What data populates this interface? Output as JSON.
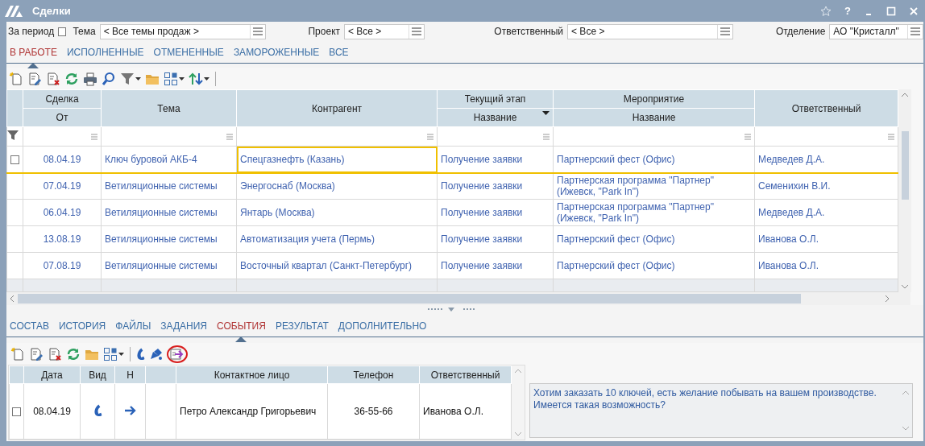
{
  "window": {
    "title": "Сделки",
    "help": "?"
  },
  "filters": {
    "period": {
      "label": "За период",
      "checked": false
    },
    "fields": [
      {
        "label": "Тема",
        "value": "< Все темы продаж >"
      },
      {
        "label": "Проект",
        "value": "< Все >"
      },
      {
        "label": "Ответственный",
        "value": "< Все >"
      },
      {
        "label": "Отделение",
        "value": "АО \"Кристалл\""
      }
    ]
  },
  "tabs": [
    {
      "label": "В РАБОТЕ",
      "selected": true
    },
    {
      "label": "ИСПОЛНЕННЫЕ",
      "selected": false
    },
    {
      "label": "ОТМЕНЕННЫЕ",
      "selected": false
    },
    {
      "label": "ЗАМОРОЖЕННЫЕ",
      "selected": false
    },
    {
      "label": "ВСЕ",
      "selected": false
    }
  ],
  "toolbar": [
    {
      "kind": "new"
    },
    {
      "kind": "edit"
    },
    {
      "kind": "delete"
    },
    {
      "kind": "refresh"
    },
    {
      "kind": "print"
    },
    {
      "kind": "search"
    },
    {
      "kind": "filter"
    },
    {
      "kind": "folder"
    },
    {
      "kind": "layout"
    },
    {
      "kind": "sort"
    }
  ],
  "table": {
    "columns": [
      {
        "group": "Сделка",
        "title": "От",
        "sorted": false
      },
      {
        "title": "Тема",
        "sorted": false
      },
      {
        "title": "Контрагент",
        "sorted": false
      },
      {
        "group": "Текущий этап",
        "title": "Название",
        "sorted": true
      },
      {
        "group": "Мероприятие",
        "title": "Название",
        "sorted": false
      },
      {
        "title": "Ответственный",
        "sorted": false
      }
    ],
    "rows": [
      {
        "selected": true,
        "cells": [
          "08.04.19",
          "Ключ буровой АКБ-4",
          "Спецгазнефть (Казань)",
          "Получение заявки",
          "Партнерский фест (Офис)",
          "Медведев Д.А."
        ]
      },
      {
        "selected": false,
        "cells": [
          "07.04.19",
          "Ветиляционные системы",
          "Энергоснаб (Москва)",
          "Получение заявки",
          "Партнерская программа \"Партнер\" (Ижевск, \"Park In\")",
          "Семенихин В.И."
        ]
      },
      {
        "selected": false,
        "cells": [
          "06.04.19",
          "Ветиляционные системы",
          "Янтарь (Москва)",
          "Получение заявки",
          "Партнерская программа \"Партнер\" (Ижевск, \"Park In\")",
          "Медведев Д.А."
        ]
      },
      {
        "selected": false,
        "cells": [
          "13.08.19",
          "Ветиляционные системы",
          "Автоматизация учета (Пермь)",
          "Получение заявки",
          "Партнерский фест (Офис)",
          "Иванова О.Л."
        ]
      },
      {
        "selected": false,
        "cells": [
          "07.08.19",
          "Ветиляционные системы",
          "Восточный квартал (Санкт-Петербург)",
          "Получение заявки",
          "Партнерский фест (Офис)",
          "Иванова О.Л."
        ]
      }
    ]
  },
  "detail_tabs": [
    {
      "label": "СОСТАВ",
      "selected": false
    },
    {
      "label": "ИСТОРИЯ",
      "selected": false
    },
    {
      "label": "ФАЙЛЫ",
      "selected": false
    },
    {
      "label": "ЗАДАНИЯ",
      "selected": false
    },
    {
      "label": "СОБЫТИЯ",
      "selected": true
    },
    {
      "label": "РЕЗУЛЬТАТ",
      "selected": false
    },
    {
      "label": "ДОПОЛНИТЕЛЬНО",
      "selected": false
    }
  ],
  "events_toolbar": [
    {
      "kind": "new",
      "circled": false
    },
    {
      "kind": "edit",
      "circled": false
    },
    {
      "kind": "delete",
      "circled": false
    },
    {
      "kind": "refresh",
      "circled": false
    },
    {
      "kind": "folder",
      "circled": false
    },
    {
      "kind": "layout",
      "circled": false
    },
    {
      "kind": "call",
      "circled": false
    },
    {
      "kind": "notify",
      "circled": false
    },
    {
      "kind": "export",
      "circled": true
    }
  ],
  "events": {
    "columns": [
      "Дата",
      "Вид",
      "Н",
      "Контактное лицо",
      "Телефон",
      "Ответственный"
    ],
    "rows": [
      {
        "checked": false,
        "date": "08.04.19",
        "contact": "Петро Александр Григорьевич",
        "phone": "36-55-66",
        "responsible": "Иванова О.Л."
      }
    ]
  },
  "note": "Хотим заказать 10 ключей, есть желание побывать на вашем производстве. Имеется такая возможность?"
}
